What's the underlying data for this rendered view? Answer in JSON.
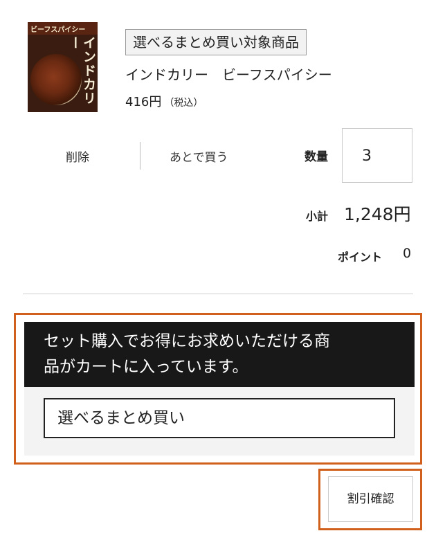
{
  "product": {
    "image_alt": "インドカリー ビーフスパイシー",
    "package_band": "ビーフスパイシー",
    "package_vertical": "インドカリー",
    "tag": "選べるまとめ買い対象商品",
    "name": "インドカリー　ビーフスパイシー",
    "price": "416円",
    "tax_note": "（税込）"
  },
  "actions": {
    "delete": "削除",
    "save_for_later": "あとで買う"
  },
  "quantity": {
    "label": "数量",
    "value": "3"
  },
  "subtotal": {
    "label": "小計",
    "value": "1,248円"
  },
  "points": {
    "label": "ポイント",
    "value": "0"
  },
  "promo": {
    "message_line1": "セット購入でお得にお求めいただける商",
    "message_line2": "品がカートに入っています。",
    "button_label": "選べるまとめ買い",
    "highlight_color": "#d0601b"
  },
  "discount": {
    "button_label": "割引確認"
  }
}
